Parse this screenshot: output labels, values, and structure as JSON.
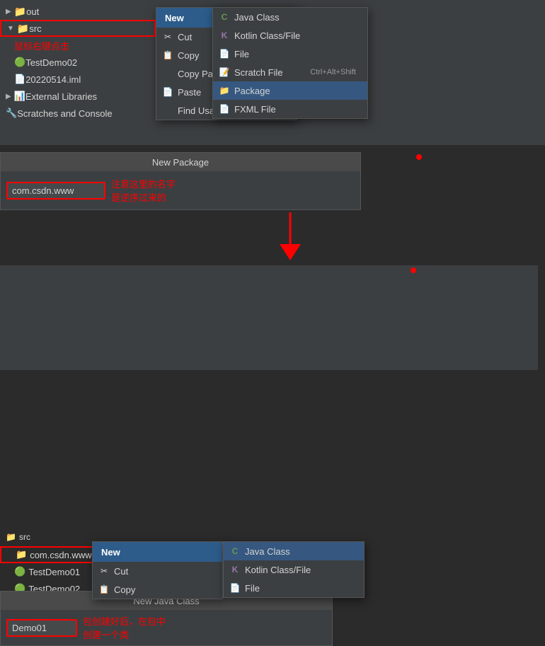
{
  "topSection": {
    "fileTree": {
      "items": [
        {
          "label": "out",
          "type": "folder",
          "indent": 0,
          "collapsed": true
        },
        {
          "label": "src",
          "type": "src-folder",
          "indent": 0,
          "collapsed": false,
          "selected": true
        },
        {
          "label": "鼠标右键点击",
          "type": "annotation",
          "indent": 1
        },
        {
          "label": "TestDemo02",
          "type": "class",
          "indent": 1
        },
        {
          "label": "20220514.iml",
          "type": "iml",
          "indent": 1
        },
        {
          "label": "External Libraries",
          "type": "external",
          "indent": 0
        },
        {
          "label": "Scratches and Console",
          "type": "scratch",
          "indent": 0
        }
      ]
    },
    "contextMenu": {
      "header": "New",
      "items": [
        {
          "label": "Cut",
          "icon": "✂",
          "shortcut": ""
        },
        {
          "label": "Copy",
          "icon": "📋",
          "shortcut": ""
        },
        {
          "label": "Copy Path/Reference...",
          "icon": "",
          "shortcut": ""
        },
        {
          "label": "Paste",
          "icon": "📄",
          "shortcut": ""
        },
        {
          "label": "Find Usages",
          "icon": "",
          "shortcut": ""
        }
      ]
    },
    "newSubmenu": {
      "items": [
        {
          "label": "Java Class",
          "icon": "C",
          "iconColor": "#629755"
        },
        {
          "label": "Kotlin Class/File",
          "icon": "K",
          "iconColor": "#9876aa"
        },
        {
          "label": "File",
          "icon": "📄",
          "iconColor": "#d4d4d4"
        },
        {
          "label": "Scratch File",
          "icon": "📝",
          "iconColor": "#cb9c5f",
          "shortcut": "Ctrl+Alt+Shift"
        },
        {
          "label": "Package",
          "icon": "📁",
          "iconColor": "#3d7ab5",
          "highlighted": true
        },
        {
          "label": "FXML File",
          "icon": "📄",
          "iconColor": "#cb9c5f"
        }
      ]
    }
  },
  "middleSection": {
    "header": "New Package",
    "inputValue": "com.csdn.www",
    "annotation": "注意这里的名字\n是逆序过来的"
  },
  "bottomSection": {
    "sectionLabel": "src",
    "fileTree": {
      "items": [
        {
          "label": "com.csdn.www",
          "type": "package",
          "indent": 1
        },
        {
          "label": "TestDemo01",
          "type": "class",
          "indent": 1
        },
        {
          "label": "TestDemo02",
          "type": "class",
          "indent": 1
        }
      ]
    },
    "contextMenu": {
      "header": "New",
      "items": [
        {
          "label": "Cut",
          "icon": "✂"
        },
        {
          "label": "Copy",
          "icon": "📋"
        }
      ]
    },
    "newSubmenu": {
      "items": [
        {
          "label": "Java Class",
          "icon": "C",
          "iconColor": "#629755",
          "highlighted": true
        },
        {
          "label": "Kotlin Class/File",
          "icon": "K",
          "iconColor": "#9876aa"
        },
        {
          "label": "File",
          "icon": "📄",
          "iconColor": "#d4d4d4"
        }
      ]
    },
    "newJavaClass": {
      "header": "New Java Class",
      "inputValue": "Demo01",
      "annotation": "包创建好后，在包中\n创建一个类"
    }
  },
  "labels": {
    "topLeftAnnotation": "鼠标右键点击",
    "midAnnotation": "注意这里的名字\n是逆序过来的",
    "bottomAnnotation": "包创建好后，在包中\n创建一个类"
  }
}
